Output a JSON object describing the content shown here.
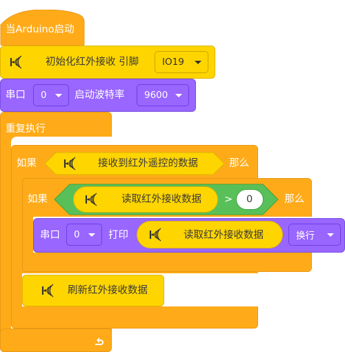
{
  "blocks": {
    "hat_label": "当Arduino启动",
    "init": {
      "label": "初始化红外接收 引脚",
      "pin": "IO19"
    },
    "serial_begin": {
      "label": "串口",
      "port": "0",
      "baud_label": "启动波特率",
      "baud": "9600"
    },
    "forever": {
      "label": "重复执行"
    },
    "if_outer": {
      "if_label": "如果",
      "condition": "接收到红外遥控的数据",
      "then_label": "那么"
    },
    "if_inner": {
      "if_label": "如果",
      "reporter": "读取红外接收数据",
      "operator": ">",
      "value": "0",
      "then_label": "那么"
    },
    "serial_print": {
      "label": "串口",
      "port": "0",
      "print_label": "打印",
      "reporter": "读取红外接收数据",
      "mode": "换行"
    },
    "refresh": {
      "label": "刷新红外接收数据"
    }
  },
  "colors": {
    "control": "#FFAB19",
    "ir": "#FFD500",
    "serial": "#9966FF",
    "operator": "#59C059"
  },
  "icons": [
    "ir-sensor-icon",
    "loop-arrow-icon",
    "dropdown-arrow-icon"
  ]
}
